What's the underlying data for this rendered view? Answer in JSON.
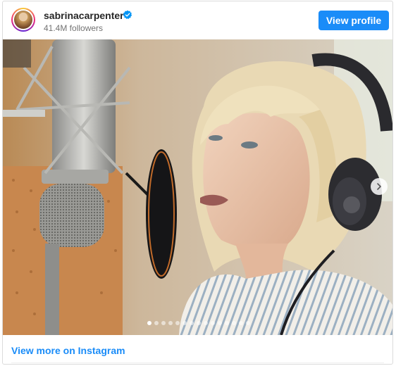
{
  "header": {
    "username": "sabrinacarpenter",
    "followers": "41.4M followers",
    "view_profile_label": "View profile"
  },
  "media": {
    "photo_count": 15,
    "active_index": 1
  },
  "footer": {
    "view_more_label": "View more on Instagram"
  },
  "colors": {
    "accent": "#1a8cf8",
    "verified": "#0095f6"
  },
  "icons": [
    "verified-badge-icon",
    "chevron-right-icon"
  ]
}
